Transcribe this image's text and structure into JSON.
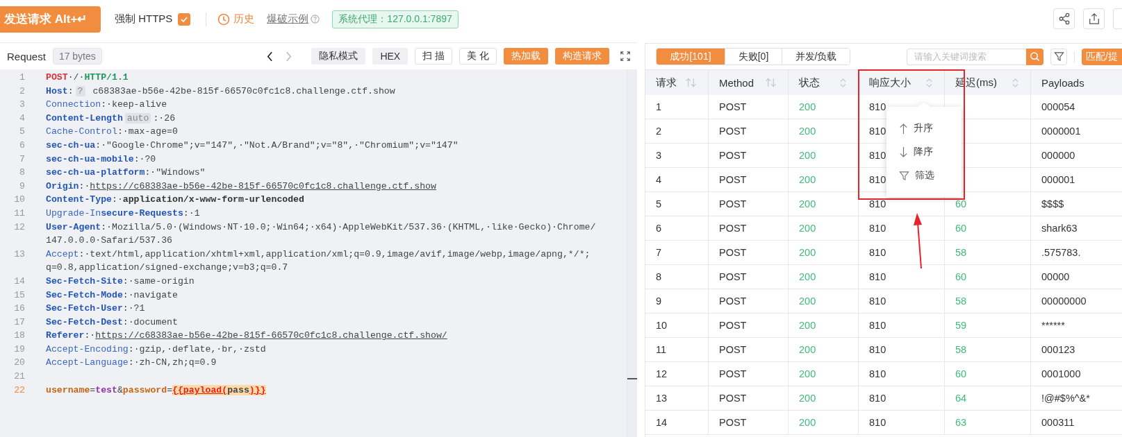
{
  "top_bar": {
    "send_button": "发送请求 Alt+↵",
    "force_https": {
      "label": "强制 HTTPS",
      "checked": true
    },
    "history": "历史",
    "example_link": "爆破示例",
    "proxy": "系统代理：127.0.0.1:7897"
  },
  "request_bar": {
    "title": "Request",
    "size": "17 bytes",
    "buttons": [
      {
        "label": "隐私模式",
        "kind": "grey"
      },
      {
        "label": "HEX",
        "kind": "grey"
      },
      {
        "label": "扫 描",
        "kind": "outline"
      },
      {
        "label": "美 化",
        "kind": "outline"
      },
      {
        "label": "热加载",
        "kind": "primary"
      },
      {
        "label": "构造请求",
        "kind": "primary"
      }
    ]
  },
  "editor": {
    "lines": [
      {
        "number": "1",
        "current": false,
        "rows": [
          [
            {
              "text": "POST",
              "kind": "method"
            },
            {
              "text": "·/·",
              "kind": "plain"
            },
            {
              "text": "HTTP/1.1",
              "kind": "version"
            }
          ]
        ]
      },
      {
        "number": "2",
        "current": false,
        "rows": [
          [
            {
              "text": "Host",
              "kind": "hkey"
            },
            {
              "text": ":",
              "kind": "plain"
            },
            {
              "text": "?",
              "kind": "badge"
            },
            {
              "text": " c68383ae-b56e-42be-815f-66570c0fc1c8.challenge.ctf.show",
              "kind": "plain"
            }
          ]
        ]
      },
      {
        "number": "3",
        "current": false,
        "rows": [
          [
            {
              "text": "Connection",
              "kind": "key"
            },
            {
              "text": ":·keep-alive",
              "kind": "plain"
            }
          ]
        ]
      },
      {
        "number": "4",
        "current": false,
        "rows": [
          [
            {
              "text": "Content-Length",
              "kind": "hkey"
            },
            {
              "text": "auto",
              "kind": "badge"
            },
            {
              "text": ":·26",
              "kind": "plain"
            }
          ]
        ]
      },
      {
        "number": "5",
        "current": false,
        "rows": [
          [
            {
              "text": "Cache-Control",
              "kind": "key"
            },
            {
              "text": ":·max-age=0",
              "kind": "plain"
            }
          ]
        ]
      },
      {
        "number": "6",
        "current": false,
        "rows": [
          [
            {
              "text": "sec-ch-ua",
              "kind": "hkey"
            },
            {
              "text": ":·\"Google·Chrome\";v=\"147\",·\"Not.A/Brand\";v=\"8\",·\"Chromium\";v=\"147\"",
              "kind": "plain"
            }
          ]
        ]
      },
      {
        "number": "7",
        "current": false,
        "rows": [
          [
            {
              "text": "sec-ch-ua-mobile",
              "kind": "hkey"
            },
            {
              "text": ":·?0",
              "kind": "plain"
            }
          ]
        ]
      },
      {
        "number": "8",
        "current": false,
        "rows": [
          [
            {
              "text": "sec-ch-ua-platform",
              "kind": "hkey"
            },
            {
              "text": ":·\"Windows\"",
              "kind": "plain"
            }
          ]
        ]
      },
      {
        "number": "9",
        "current": false,
        "rows": [
          [
            {
              "text": "Origin",
              "kind": "hkey"
            },
            {
              "text": ":·",
              "kind": "plain"
            },
            {
              "text": "https://c68383ae-b56e-42be-815f-66570c0fc1c8.challenge.ctf.show",
              "kind": "url"
            }
          ]
        ]
      },
      {
        "number": "10",
        "current": false,
        "rows": [
          [
            {
              "text": "Content-Type",
              "kind": "hkey"
            },
            {
              "text": ":·",
              "kind": "plain"
            },
            {
              "text": "application/x-www-form-urlencoded",
              "kind": "strong"
            }
          ]
        ]
      },
      {
        "number": "11",
        "current": false,
        "rows": [
          [
            {
              "text": "Upgrade-In",
              "kind": "key"
            },
            {
              "text": "secure-Requests",
              "kind": "hkey"
            },
            {
              "text": ":·1",
              "kind": "plain"
            }
          ]
        ]
      },
      {
        "number": "12",
        "current": false,
        "rows": [
          [
            {
              "text": "User-Agent",
              "kind": "hkey"
            },
            {
              "text": ":·Mozilla/5.0·(Windows·NT·10.0;·Win64;·x64)·AppleWebKit/537.36·(KHTML,·like·Gecko)·Chrome/",
              "kind": "plain"
            }
          ],
          [
            {
              "text": "147.0.0.0·Safari/537.36",
              "kind": "plain"
            }
          ]
        ]
      },
      {
        "number": "13",
        "current": false,
        "rows": [
          [
            {
              "text": "Accept",
              "kind": "key"
            },
            {
              "text": ":·text/html,application/xhtml+xml,application/xml;q=0.9,image/avif,image/webp,image/apng,*/*;",
              "kind": "plain"
            }
          ],
          [
            {
              "text": "q=0.8,application/signed-exchange;v=b3;q=0.7",
              "kind": "plain"
            }
          ]
        ]
      },
      {
        "number": "14",
        "current": false,
        "rows": [
          [
            {
              "text": "Sec-Fetch-Site",
              "kind": "hkey"
            },
            {
              "text": ":·same-origin",
              "kind": "plain"
            }
          ]
        ]
      },
      {
        "number": "15",
        "current": false,
        "rows": [
          [
            {
              "text": "Sec-Fetch-Mode",
              "kind": "hkey"
            },
            {
              "text": ":·navigate",
              "kind": "plain"
            }
          ]
        ]
      },
      {
        "number": "16",
        "current": false,
        "rows": [
          [
            {
              "text": "Sec-Fetch-User",
              "kind": "hkey"
            },
            {
              "text": ":·?1",
              "kind": "plain"
            }
          ]
        ]
      },
      {
        "number": "17",
        "current": false,
        "rows": [
          [
            {
              "text": "Sec-Fetch-Dest",
              "kind": "hkey"
            },
            {
              "text": ":·document",
              "kind": "plain"
            }
          ]
        ]
      },
      {
        "number": "18",
        "current": false,
        "rows": [
          [
            {
              "text": "Referer",
              "kind": "hkey"
            },
            {
              "text": ":·",
              "kind": "plain"
            },
            {
              "text": "https://c68383ae-b56e-42be-815f-66570c0fc1c8.challenge.ctf.show/",
              "kind": "url"
            }
          ]
        ]
      },
      {
        "number": "19",
        "current": false,
        "rows": [
          [
            {
              "text": "Accept-Encoding",
              "kind": "key"
            },
            {
              "text": ":·gzip,·deflate,·br,·zstd",
              "kind": "plain"
            }
          ]
        ]
      },
      {
        "number": "20",
        "current": false,
        "rows": [
          [
            {
              "text": "Accept-Language",
              "kind": "key"
            },
            {
              "text": ":·zh-CN,zh;q=0.9",
              "kind": "plain"
            }
          ]
        ]
      },
      {
        "number": "21",
        "current": false
      },
      {
        "number": "22",
        "current": true,
        "rows": [
          [
            {
              "text": "username",
              "kind": "param"
            },
            {
              "text": "=",
              "kind": "plain"
            },
            {
              "text": "test",
              "kind": "pval"
            },
            {
              "text": "&",
              "kind": "plain"
            },
            {
              "text": "password",
              "kind": "param"
            },
            {
              "text": "=",
              "kind": "plain"
            },
            {
              "text": "{{payload(",
              "kind": "payload"
            },
            {
              "text": "pass",
              "kind": "payload_arg"
            },
            {
              "text": ")}}",
              "kind": "payload"
            }
          ]
        ]
      }
    ]
  },
  "results": {
    "tabs": [
      {
        "label": "成功[101]",
        "selected": true
      },
      {
        "label": "失败[0]",
        "selected": false
      },
      {
        "label": "并发/负载",
        "selected": false
      }
    ],
    "search": {
      "placeholder": "请输入关键词搜索"
    },
    "match_button": "匹配/提",
    "table": {
      "columns": [
        {
          "label": "请求",
          "kind": "arrows"
        },
        {
          "label": "Method",
          "kind": "arrows"
        },
        {
          "label": "状态",
          "kind": "chevrons"
        },
        {
          "label": "响应大小",
          "kind": "chevrons"
        },
        {
          "label": "延迟(ms)",
          "kind": "chevrons"
        },
        {
          "label": "Payloads",
          "kind": "plain"
        }
      ],
      "rows": [
        {
          "id": "1",
          "method": "POST",
          "status": "200",
          "size": "810",
          "payload": "000054"
        },
        {
          "id": "2",
          "method": "POST",
          "status": "200",
          "size": "810",
          "payload": "0000001"
        },
        {
          "id": "3",
          "method": "POST",
          "status": "200",
          "size": "810",
          "payload": "000000"
        },
        {
          "id": "4",
          "method": "POST",
          "status": "200",
          "size": "810",
          "payload": "000001"
        },
        {
          "id": "5",
          "method": "POST",
          "status": "200",
          "size": "810",
          "delay": "60",
          "payload": "$$$$"
        },
        {
          "id": "6",
          "method": "POST",
          "status": "200",
          "size": "810",
          "delay": "60",
          "payload": "shark63"
        },
        {
          "id": "7",
          "method": "POST",
          "status": "200",
          "size": "810",
          "delay": "58",
          "payload": ".575783."
        },
        {
          "id": "8",
          "method": "POST",
          "status": "200",
          "size": "810",
          "delay": "60",
          "payload": "00000"
        },
        {
          "id": "9",
          "method": "POST",
          "status": "200",
          "size": "810",
          "delay": "58",
          "payload": "00000000"
        },
        {
          "id": "10",
          "method": "POST",
          "status": "200",
          "size": "810",
          "delay": "59",
          "payload": "******"
        },
        {
          "id": "11",
          "method": "POST",
          "status": "200",
          "size": "810",
          "delay": "58",
          "payload": "000123"
        },
        {
          "id": "12",
          "method": "POST",
          "status": "200",
          "size": "810",
          "delay": "60",
          "payload": "0001000"
        },
        {
          "id": "13",
          "method": "POST",
          "status": "200",
          "size": "810",
          "delay": "64",
          "payload": "!@#$%^&*"
        },
        {
          "id": "14",
          "method": "POST",
          "status": "200",
          "size": "810",
          "delay": "63",
          "payload": "000311"
        }
      ]
    },
    "sort_menu": [
      {
        "kind": "asc",
        "label": "升序"
      },
      {
        "kind": "desc",
        "label": "降序"
      },
      {
        "kind": "filter",
        "label": "筛选"
      }
    ]
  }
}
